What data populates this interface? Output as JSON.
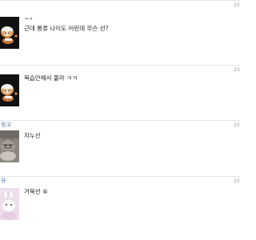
{
  "comments": [
    {
      "author": "",
      "reply_prefix": "ㅋㅋ",
      "text": "근데 롱류 나이도 어린데 무슨 선?",
      "time": "20",
      "avatar": "chibi-character-icon"
    },
    {
      "author": "",
      "reply_prefix": "",
      "text": "복습안해서 몰라 ㅋㅋ",
      "time": "20",
      "avatar": "chibi-character-icon"
    },
    {
      "author": "링고",
      "reply_prefix": "",
      "text": "지누선",
      "time": "20",
      "avatar": "cat-photo-icon"
    },
    {
      "author": "뀨",
      "reply_prefix": "",
      "text": "거북선 ⑥",
      "time": "20",
      "avatar": "bunny-character-icon"
    }
  ]
}
